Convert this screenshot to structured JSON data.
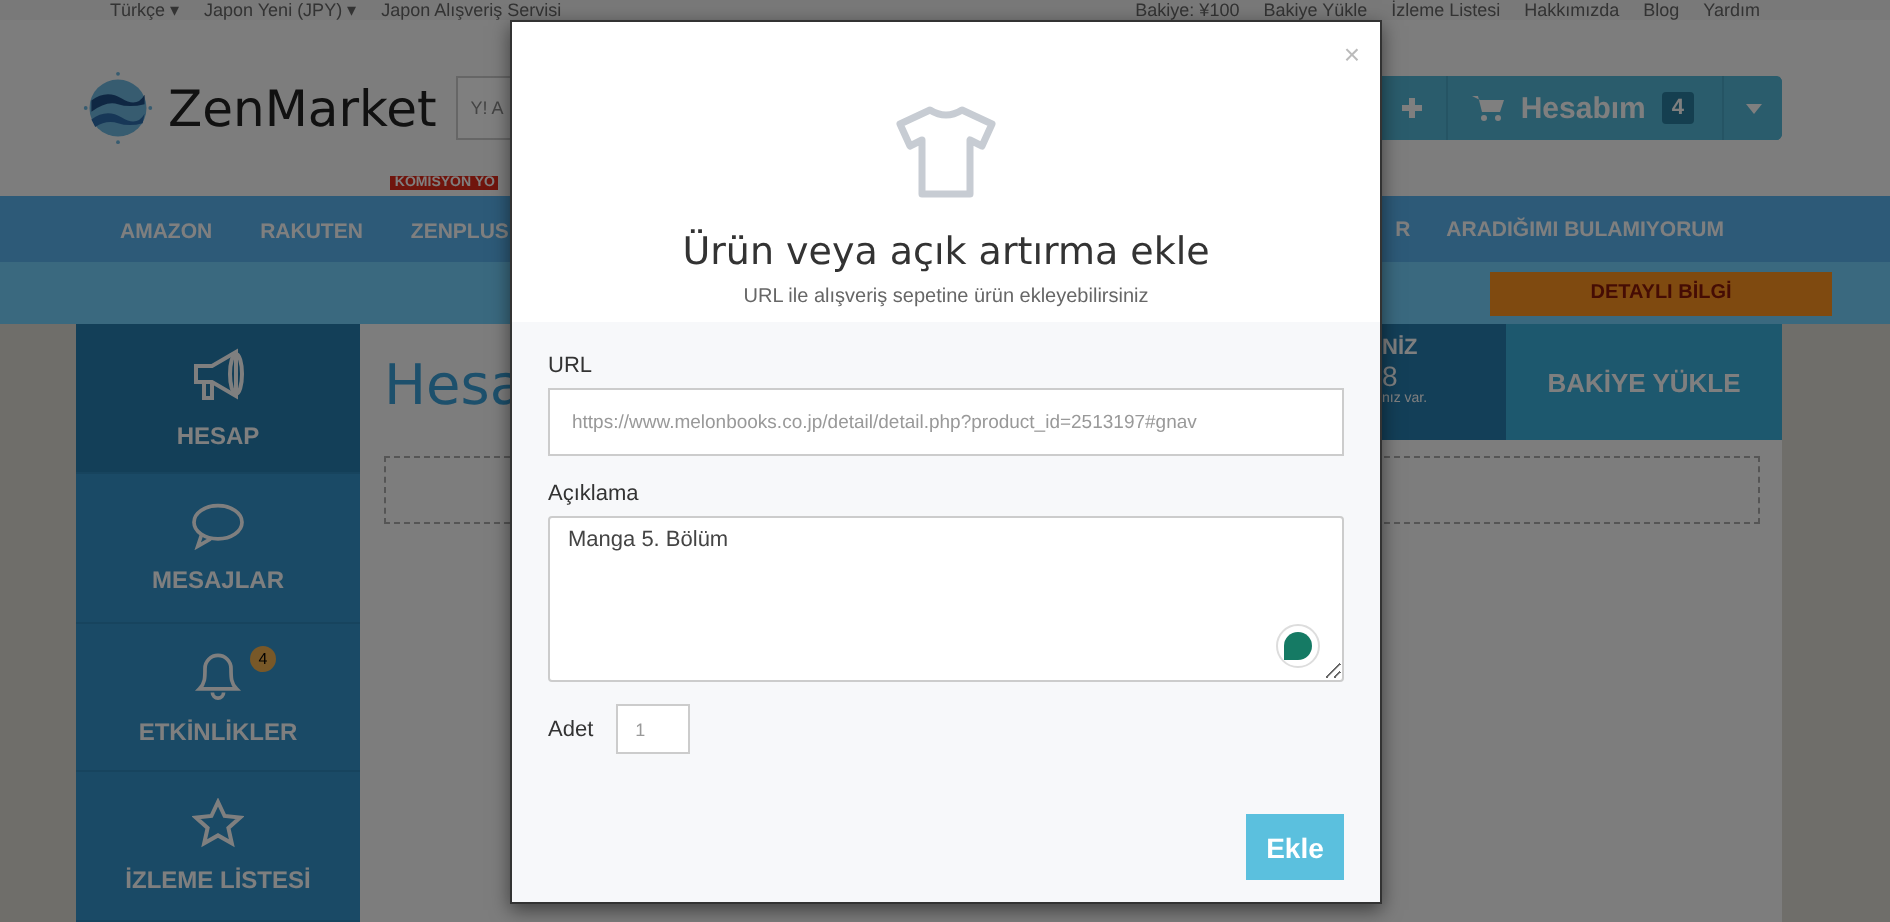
{
  "top_bar": {
    "left": [
      "Türkçe ▾",
      "Japon Yeni (JPY) ▾",
      "Japon Alışveriş Servisi"
    ],
    "right": [
      "Bakiye: ¥100",
      "Bakiye Yükle",
      "İzleme Listesi",
      "Hakkımızda",
      "Blog",
      "Yardım"
    ]
  },
  "header": {
    "logo_text": "ZenMarket",
    "search_placeholder": "Y! A",
    "account_label": "Hesabım",
    "cart_count": "4"
  },
  "nav": {
    "left": [
      {
        "label": "AMAZON"
      },
      {
        "label": "RAKUTEN"
      },
      {
        "label": "ZENPLUS",
        "badge": "KOMİSYON YO"
      }
    ],
    "right": [
      {
        "label": "R"
      },
      {
        "label": "ARADIĞIMI BULAMIYORUM"
      }
    ]
  },
  "promo_button": "DETAYLI BİLGİ",
  "sidebar": {
    "items": [
      {
        "kind": "megaphone",
        "label": "HESAP",
        "selected": true
      },
      {
        "kind": "chat",
        "label": "MESAJLAR",
        "selected": false
      },
      {
        "kind": "bell",
        "label": "ETKİNLİKLER",
        "selected": false,
        "badge": "4"
      },
      {
        "kind": "star",
        "label": "İZLEME LİSTESİ",
        "selected": false
      }
    ]
  },
  "page_title": "Hesa",
  "balance_card": {
    "heading": "NİZ",
    "amount": "8",
    "note": "nız var.",
    "button": "BAKİYE YÜKLE"
  },
  "modal": {
    "close": "×",
    "title": "Ürün veya açık artırma ekle",
    "subtitle": "URL ile alışveriş sepetine ürün ekleyebilirsiniz",
    "url_label": "URL",
    "url_placeholder": "https://www.melonbooks.co.jp/detail/detail.php?product_id=2513197#gnav",
    "description_label": "Açıklama",
    "description_value": "Manga 5. Bölüm",
    "quantity_label": "Adet",
    "quantity_placeholder": "1",
    "submit": "Ekle"
  }
}
